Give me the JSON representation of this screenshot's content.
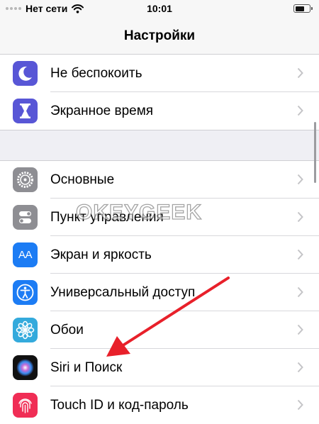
{
  "status_bar": {
    "carrier": "Нет сети",
    "time": "10:01",
    "battery_level": 0.7
  },
  "nav": {
    "title": "Настройки"
  },
  "groups": [
    {
      "items": [
        {
          "label": "Не беспокоить",
          "icon": "moon-icon",
          "color": "#5856d6"
        },
        {
          "label": "Экранное время",
          "icon": "hourglass-icon",
          "color": "#5856d6"
        }
      ]
    },
    {
      "items": [
        {
          "label": "Основные",
          "icon": "gear-icon",
          "color": "#8e8e93"
        },
        {
          "label": "Пункт управления",
          "icon": "toggle-switches-icon",
          "color": "#8e8e93"
        },
        {
          "label": "Экран и яркость",
          "icon": "text-size-icon",
          "color": "#1c7cf4",
          "icon_text": "AA"
        },
        {
          "label": "Универсальный доступ",
          "icon": "accessibility-icon",
          "color": "#1c7cf4"
        },
        {
          "label": "Обои",
          "icon": "flower-icon",
          "color": "#34aadc"
        },
        {
          "label": "Siri и Поиск",
          "icon": "siri-icon",
          "color": "#111111"
        },
        {
          "label": "Touch ID и код-пароль",
          "icon": "fingerprint-icon",
          "color": "#f02d55"
        }
      ]
    }
  ],
  "watermark": "OKEYGEEK",
  "annotation_color": "#e8202a"
}
